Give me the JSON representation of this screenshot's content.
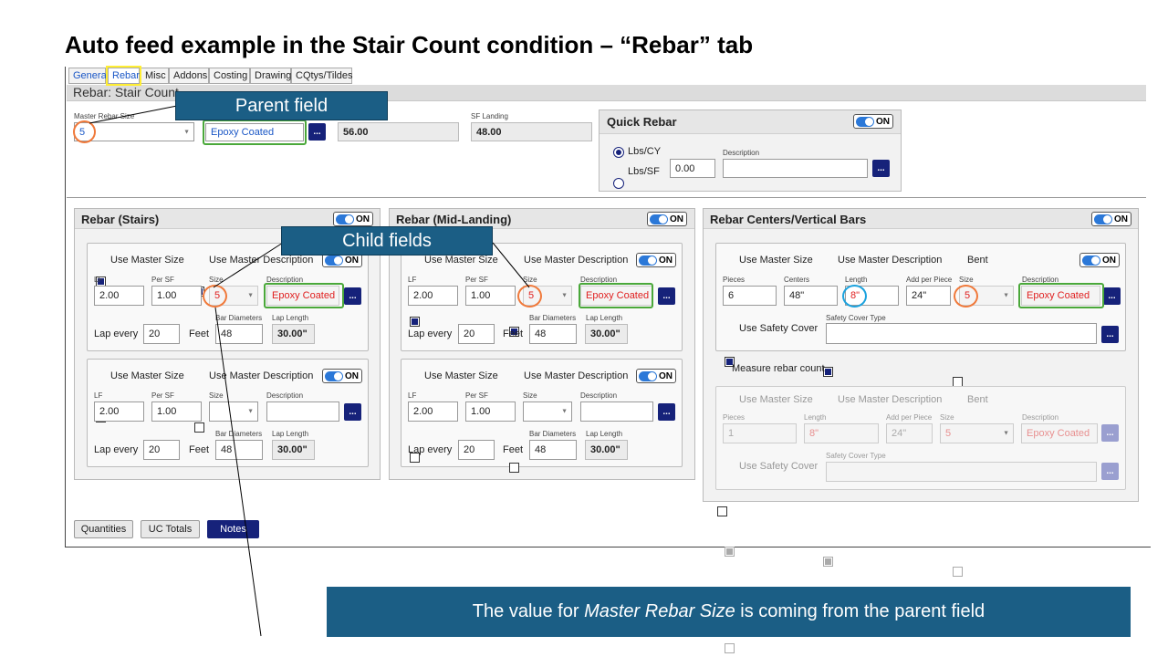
{
  "slide": {
    "title": "Auto feed example in the Stair Count condition – “Rebar” tab",
    "callout_parent": "Parent field",
    "callout_child": "Child fields",
    "banner_pre": "The value for ",
    "banner_em": "Master Rebar Size",
    "banner_post": " is coming from the parent field"
  },
  "tabs": [
    "General",
    "Rebar",
    "Misc",
    "Addons",
    "Costing",
    "Drawing",
    "CQtys/Tildes"
  ],
  "header": {
    "title": "Rebar: Stair Count"
  },
  "top": {
    "master_rebar_size_label": "Master Rebar Size",
    "master_rebar_size_value": "5",
    "description_value": "Epoxy Coated",
    "dots": "...",
    "value_1": "56.00",
    "sf_landing_label": "SF Landing",
    "sf_landing_value": "48.00"
  },
  "quick_rebar": {
    "title": "Quick Rebar",
    "toggle": "ON",
    "lbs_cy": "Lbs/CY",
    "lbs_sf": "Lbs/SF",
    "value": "0.00",
    "description_label": "Description",
    "description_value": ""
  },
  "labels": {
    "lf": "LF",
    "per_sf": "Per SF",
    "size": "Size",
    "description": "Description",
    "bar_diameters": "Bar Diameters",
    "lap_length": "Lap Length",
    "lap_every": "Lap every",
    "feet": "Feet",
    "use_master_size": "Use Master Size",
    "use_master_description": "Use Master Description",
    "on": "ON"
  },
  "stairs": {
    "title": "Rebar (Stairs)",
    "g1": {
      "lf": "2.00",
      "per_sf": "1.00",
      "size": "5",
      "description": "Epoxy Coated",
      "lap_every": "20",
      "bar_diameters": "48",
      "lap_length": "30.00\""
    },
    "g2": {
      "lf": "2.00",
      "per_sf": "1.00",
      "size": "",
      "description": "",
      "lap_every": "20",
      "bar_diameters": "48",
      "lap_length": "30.00\""
    }
  },
  "mid": {
    "title": "Rebar (Mid-Landing)",
    "g1": {
      "lf": "2.00",
      "per_sf": "1.00",
      "size": "5",
      "description": "Epoxy Coated",
      "lap_every": "20",
      "bar_diameters": "48",
      "lap_length": "30.00\""
    },
    "g2": {
      "lf": "2.00",
      "per_sf": "1.00",
      "size": "",
      "description": "",
      "lap_every": "20",
      "bar_diameters": "48",
      "lap_length": "30.00\""
    }
  },
  "centers": {
    "title": "Rebar Centers/Vertical Bars",
    "toggle": "ON",
    "g1": {
      "use_master_size": "Use Master Size",
      "use_master_description": "Use Master Description",
      "bent": "Bent",
      "pieces_label": "Pieces",
      "pieces": "6",
      "centers_label": "Centers",
      "centers": "48\"",
      "length_label": "Length",
      "length": "8\"",
      "add_per_piece_label": "Add per Piece",
      "add_per_piece": "24\"",
      "size_label": "Size",
      "size": "5",
      "description_label": "Description",
      "description": "Epoxy Coated",
      "use_safety_cover": "Use Safety Cover",
      "safety_cover_type_label": "Safety Cover Type",
      "safety_cover_type": ""
    },
    "measure_rebar_count": "Measure rebar count",
    "g2": {
      "use_master_size": "Use Master Size",
      "use_master_description": "Use Master Description",
      "bent": "Bent",
      "pieces_label": "Pieces",
      "pieces": "1",
      "length_label": "Length",
      "length": "8\"",
      "add_per_piece_label": "Add per Piece",
      "add_per_piece": "24\"",
      "size_label": "Size",
      "size": "5",
      "description_label": "Description",
      "description": "Epoxy Coated",
      "use_safety_cover": "Use Safety Cover",
      "safety_cover_type_label": "Safety Cover Type",
      "safety_cover_type": ""
    }
  },
  "bottom": {
    "quantities": "Quantities",
    "uc_totals": "UC Totals",
    "notes": "Notes"
  }
}
